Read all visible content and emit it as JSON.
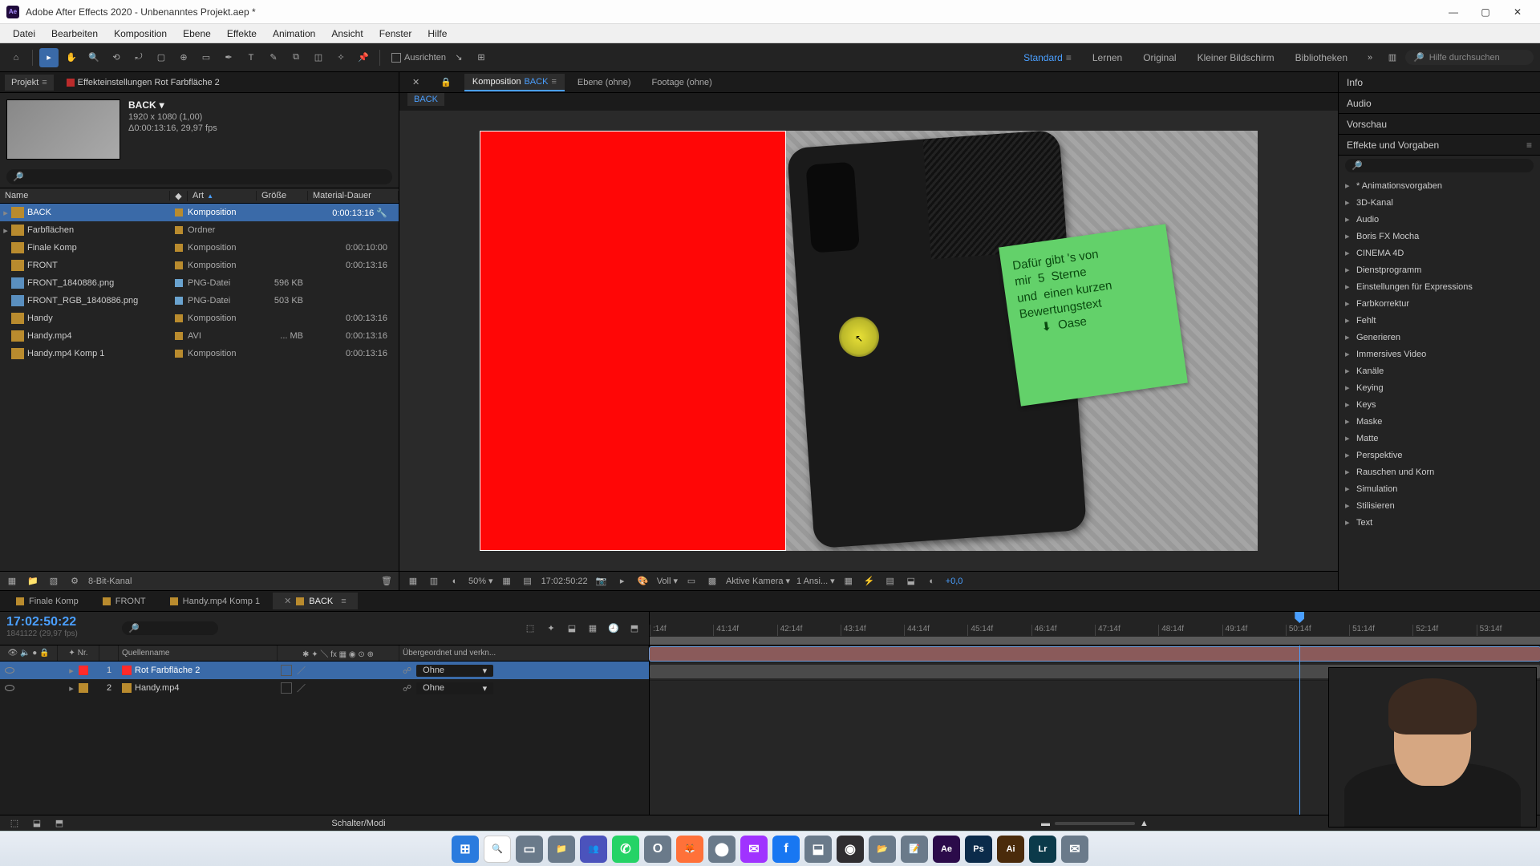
{
  "title": "Adobe After Effects 2020 - Unbenanntes Projekt.aep *",
  "menu": [
    "Datei",
    "Bearbeiten",
    "Komposition",
    "Ebene",
    "Effekte",
    "Animation",
    "Ansicht",
    "Fenster",
    "Hilfe"
  ],
  "toolbar": {
    "ausrichten": "Ausrichten",
    "workspaces": [
      "Standard",
      "Lernen",
      "Original",
      "Kleiner Bildschirm",
      "Bibliotheken"
    ],
    "active_workspace": "Standard",
    "search_help_placeholder": "Hilfe durchsuchen"
  },
  "project_panel": {
    "tabs": {
      "project": "Projekt",
      "effect_controls": "Effekteinstellungen  Rot Farbfläche 2"
    },
    "selected_meta": {
      "name": "BACK",
      "dims": "1920 x 1080 (1,00)",
      "dur_fps": "Δ0:00:13:16, 29,97 fps"
    },
    "columns": {
      "name": "Name",
      "art": "Art",
      "size": "Größe",
      "dauer": "Material-Dauer"
    },
    "rows": [
      {
        "name": "BACK",
        "art": "Komposition",
        "size": "",
        "dauer": "0:00:13:16",
        "icon": "comp",
        "label": "#b98b2e",
        "selected": true,
        "expand": true
      },
      {
        "name": "Farbflächen",
        "art": "Ordner",
        "size": "",
        "dauer": "",
        "icon": "folder",
        "label": "#b98b2e",
        "expand": true
      },
      {
        "name": "Finale Komp",
        "art": "Komposition",
        "size": "",
        "dauer": "0:00:10:00",
        "icon": "comp",
        "label": "#b98b2e"
      },
      {
        "name": "FRONT",
        "art": "Komposition",
        "size": "",
        "dauer": "0:00:13:16",
        "icon": "comp",
        "label": "#b98b2e"
      },
      {
        "name": "FRONT_1840886.png",
        "art": "PNG-Datei",
        "size": "596 KB",
        "dauer": "",
        "icon": "png",
        "label": "#6aa3cf"
      },
      {
        "name": "FRONT_RGB_1840886.png",
        "art": "PNG-Datei",
        "size": "503 KB",
        "dauer": "",
        "icon": "png",
        "label": "#6aa3cf"
      },
      {
        "name": "Handy",
        "art": "Komposition",
        "size": "",
        "dauer": "0:00:13:16",
        "icon": "comp",
        "label": "#b98b2e"
      },
      {
        "name": "Handy.mp4",
        "art": "AVI",
        "size": "... MB",
        "dauer": "0:00:13:16",
        "icon": "avi",
        "label": "#b98b2e"
      },
      {
        "name": "Handy.mp4 Komp 1",
        "art": "Komposition",
        "size": "",
        "dauer": "0:00:13:16",
        "icon": "comp",
        "label": "#b98b2e"
      }
    ],
    "bottom": {
      "bitdepth": "8-Bit-Kanal"
    }
  },
  "composition_panel": {
    "tabs": {
      "comp_prefix": "Komposition",
      "comp_name": "BACK",
      "ebene": "Ebene  (ohne)",
      "footage": "Footage  (ohne)"
    },
    "breadcrumb": "BACK",
    "note_lines": [
      "Dafür gibt 's von",
      "mir  5  Sterne",
      "und  einen kurzen",
      "Bewertungstext",
      "      ⬇  Oase"
    ],
    "viewer_bar": {
      "zoom": "50%",
      "timecode": "17:02:50:22",
      "res": "Voll",
      "camera": "Aktive Kamera",
      "views": "1 Ansi...",
      "exposure": "+0,0"
    }
  },
  "right_panels": {
    "info": "Info",
    "audio": "Audio",
    "vorschau": "Vorschau",
    "effects": "Effekte und Vorgaben",
    "fx_items": [
      "* Animationsvorgaben",
      "3D-Kanal",
      "Audio",
      "Boris FX Mocha",
      "CINEMA 4D",
      "Dienstprogramm",
      "Einstellungen für Expressions",
      "Farbkorrektur",
      "Fehlt",
      "Generieren",
      "Immersives Video",
      "Kanäle",
      "Keying",
      "Keys",
      "Maske",
      "Matte",
      "Perspektive",
      "Rauschen und Korn",
      "Simulation",
      "Stilisieren",
      "Text"
    ]
  },
  "timeline": {
    "tabs": [
      {
        "label": "Finale Komp",
        "color": "#b98b2e"
      },
      {
        "label": "FRONT",
        "color": "#b98b2e"
      },
      {
        "label": "Handy.mp4 Komp 1",
        "color": "#b98b2e"
      },
      {
        "label": "BACK",
        "color": "#b98b2e",
        "active": true
      }
    ],
    "timecode": "17:02:50:22",
    "frames": "1841122 (29,97 fps)",
    "columns": {
      "nr": "Nr.",
      "quellenname": "Quellenname",
      "parent": "Übergeordnet und verkn..."
    },
    "layers": [
      {
        "idx": "1",
        "name": "Rot Farbfläche 2",
        "color": "#ff2b2b",
        "parent": "Ohne",
        "selected": true
      },
      {
        "idx": "2",
        "name": "Handy.mp4",
        "color": "#b98b2e",
        "parent": "Ohne"
      }
    ],
    "ruler_labels": [
      ":14f",
      "41:14f",
      "42:14f",
      "43:14f",
      "44:14f",
      "45:14f",
      "46:14f",
      "47:14f",
      "48:14f",
      "49:14f",
      "50:14f",
      "51:14f",
      "52:14f",
      "53:14f"
    ],
    "playhead_pct": 73,
    "footer_label": "Schalter/Modi"
  },
  "taskbar": {
    "apps": [
      "windows",
      "search",
      "tasks",
      "explorer",
      "teams",
      "whatsapp",
      "opera",
      "firefox",
      "app1",
      "messenger",
      "facebook",
      "app2",
      "obs",
      "files",
      "notes",
      "ae",
      "ps",
      "ai",
      "lr",
      "mail"
    ]
  }
}
